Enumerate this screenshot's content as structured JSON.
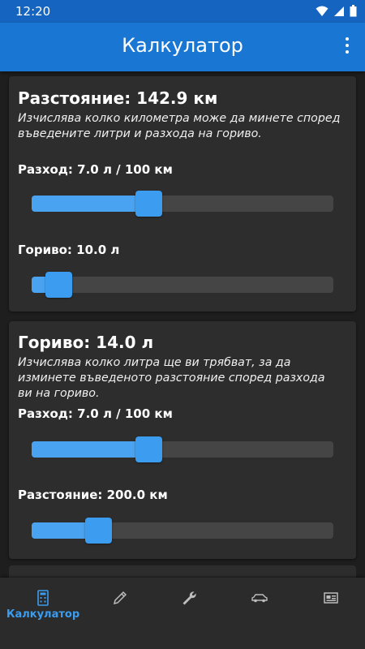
{
  "status_bar": {
    "time": "12:20"
  },
  "app_bar": {
    "title": "Калкулатор"
  },
  "cards": [
    {
      "title": "Разстояние: 142.9 км",
      "description": "Изчислява колко километра може да минете според въведените литри и разхода на гориво.",
      "sliders": [
        {
          "label": "Разход: 7.0 л / 100 км",
          "level_percent": 34
        },
        {
          "label": "Гориво: 10.0 л",
          "level_percent": 8
        }
      ]
    },
    {
      "title": "Гориво: 14.0 л",
      "description": "Изчислява колко литра ще ви трябват, за да изминете въведеното разстояние според разхода ви на гориво.",
      "sliders": [
        {
          "label": "Разход: 7.0 л / 100 км",
          "level_percent": 34
        },
        {
          "label": "Разстояние: 200.0 км",
          "level_percent": 19
        }
      ]
    }
  ],
  "bottom_nav": {
    "items": [
      {
        "icon": "calculator-icon",
        "label": "Калкулатор",
        "selected": true
      },
      {
        "icon": "pencil-icon",
        "label": "",
        "selected": false
      },
      {
        "icon": "wrench-icon",
        "label": "",
        "selected": false
      },
      {
        "icon": "car-icon",
        "label": "",
        "selected": false
      },
      {
        "icon": "news-icon",
        "label": "",
        "selected": false
      }
    ]
  },
  "colors": {
    "app_bar": "#1976d2",
    "status_bar": "#1565c0",
    "accent": "#3b9cf0",
    "card": "#2d2d2d",
    "background": "#1e1e1e"
  }
}
